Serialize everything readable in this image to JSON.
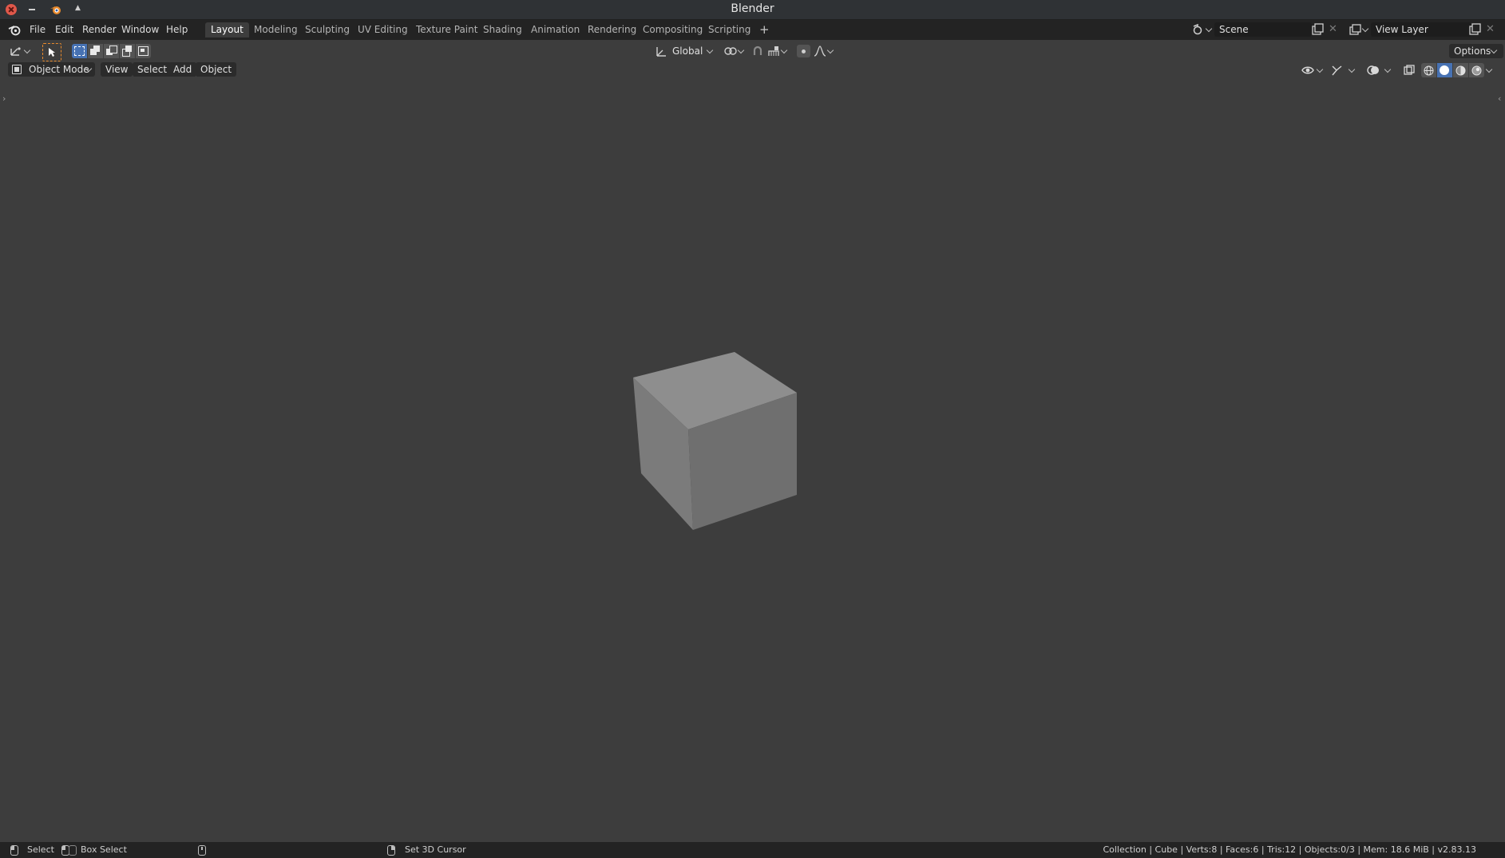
{
  "window": {
    "title": "Blender"
  },
  "menubar": {
    "items": [
      "File",
      "Edit",
      "Render",
      "Window",
      "Help"
    ]
  },
  "workspaces": {
    "tabs": [
      "Layout",
      "Modeling",
      "Sculpting",
      "UV Editing",
      "Texture Paint",
      "Shading",
      "Animation",
      "Rendering",
      "Compositing",
      "Scripting"
    ],
    "active": "Layout",
    "add_label": "+"
  },
  "scene": {
    "name": "Scene"
  },
  "view_layer": {
    "name": "View Layer"
  },
  "tool_header": {
    "transform_orientation": "Global",
    "options_label": "Options"
  },
  "viewport_header": {
    "mode": "Object Mode",
    "menus": [
      "View",
      "Select",
      "Add",
      "Object"
    ]
  },
  "statusbar": {
    "select": "Select",
    "box_select": "Box Select",
    "set_cursor": "Set 3D Cursor",
    "stats": "Collection | Cube | Verts:8 | Faces:6 | Tris:12 | Objects:0/3 | Mem: 18.6 MiB | v2.83.13"
  },
  "colors": {
    "accent_orange": "#e98a2c",
    "active_select_blue": "#4772b3",
    "viewport_bg": "#3d3d3d",
    "cube_top": "#8d8d8d",
    "cube_left": "#7b7b7b",
    "cube_right": "#6e6e6e"
  }
}
